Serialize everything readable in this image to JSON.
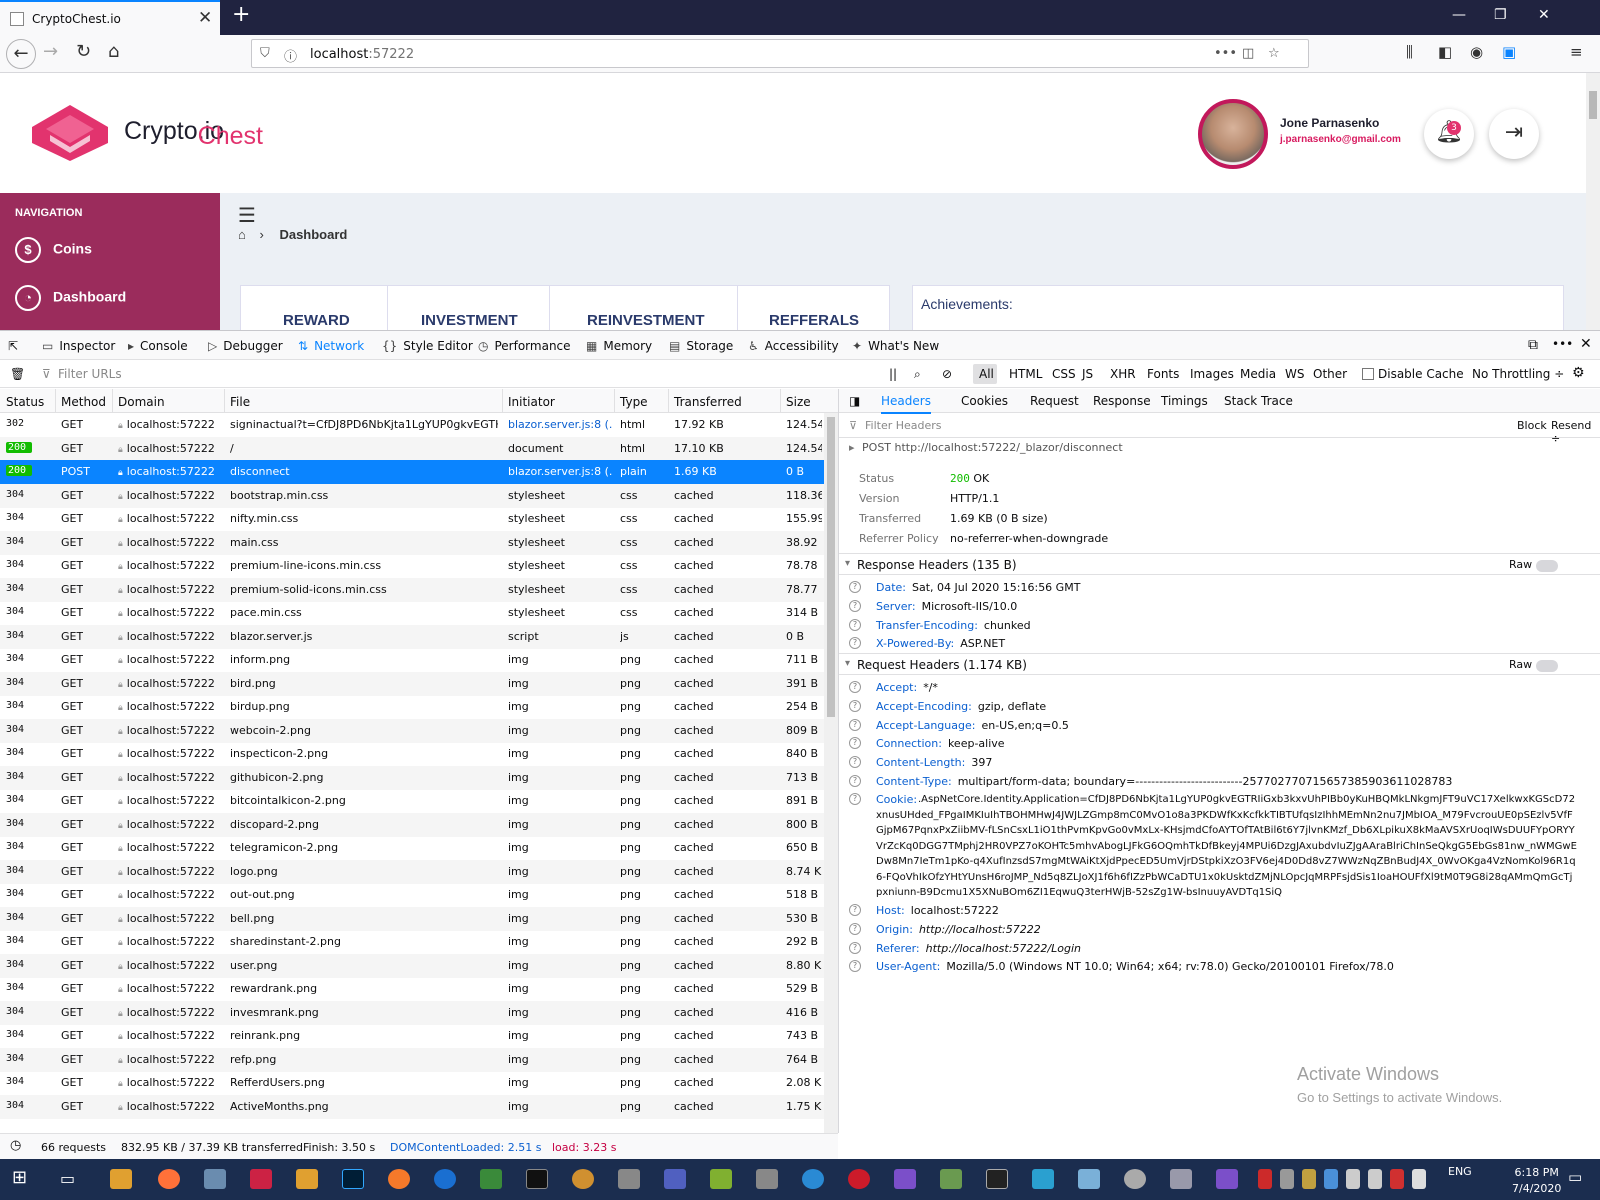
{
  "browser": {
    "tab_title": "CryptoChest.io",
    "url_host": "localhost",
    "url_port": ":57222"
  },
  "page": {
    "brand_a": "Crypto",
    "brand_b": "Chest",
    "brand_c": ".io",
    "user_name": "Jone Parnasenko",
    "user_email": "j.parnasenko@gmail.com",
    "notification_count": "3",
    "nav_heading": "NAVIGATION",
    "nav_items": [
      "Coins",
      "Dashboard"
    ],
    "breadcrumb": "Dashboard",
    "tabs": [
      "REWARD",
      "INVESTMENT",
      "REINVESTMENT",
      "REFFERALS"
    ],
    "achievements": "Achievements:"
  },
  "devtools": {
    "tools": [
      "Inspector",
      "Console",
      "Debugger",
      "Network",
      "Style Editor",
      "Performance",
      "Memory",
      "Storage",
      "Accessibility",
      "What's New"
    ],
    "filter_placeholder": "Filter URLs",
    "type_filters": [
      "All",
      "HTML",
      "CSS",
      "JS",
      "XHR",
      "Fonts",
      "Images",
      "Media",
      "WS",
      "Other"
    ],
    "disable_cache": "Disable Cache",
    "throttling": "No Throttling ÷",
    "columns": [
      "Status",
      "Method",
      "Domain",
      "File",
      "Initiator",
      "Type",
      "Transferred",
      "Size"
    ],
    "requests": [
      {
        "status": "302",
        "method": "GET",
        "domain": "localhost:57222",
        "file": "signinactual?t=CfDJ8PD6NbKjta1LgYUP0gkvEGTHv...",
        "initiator": "blazor.server.js:8 (...",
        "type": "html",
        "transferred": "17.92 KB",
        "size": "124.54 ..."
      },
      {
        "status": "200",
        "method": "GET",
        "domain": "localhost:57222",
        "file": "/",
        "initiator": "document",
        "type": "html",
        "transferred": "17.10 KB",
        "size": "124.54 ..."
      },
      {
        "status": "200",
        "method": "POST",
        "domain": "localhost:57222",
        "file": "disconnect",
        "initiator": "blazor.server.js:8 (...",
        "type": "plain",
        "transferred": "1.69 KB",
        "size": "0 B"
      },
      {
        "status": "304",
        "method": "GET",
        "domain": "localhost:57222",
        "file": "bootstrap.min.css",
        "initiator": "stylesheet",
        "type": "css",
        "transferred": "cached",
        "size": "118.36 ..."
      },
      {
        "status": "304",
        "method": "GET",
        "domain": "localhost:57222",
        "file": "nifty.min.css",
        "initiator": "stylesheet",
        "type": "css",
        "transferred": "cached",
        "size": "155.99 ..."
      },
      {
        "status": "304",
        "method": "GET",
        "domain": "localhost:57222",
        "file": "main.css",
        "initiator": "stylesheet",
        "type": "css",
        "transferred": "cached",
        "size": "38.92 KB"
      },
      {
        "status": "304",
        "method": "GET",
        "domain": "localhost:57222",
        "file": "premium-line-icons.min.css",
        "initiator": "stylesheet",
        "type": "css",
        "transferred": "cached",
        "size": "78.78 KB"
      },
      {
        "status": "304",
        "method": "GET",
        "domain": "localhost:57222",
        "file": "premium-solid-icons.min.css",
        "initiator": "stylesheet",
        "type": "css",
        "transferred": "cached",
        "size": "78.77 KB"
      },
      {
        "status": "304",
        "method": "GET",
        "domain": "localhost:57222",
        "file": "pace.min.css",
        "initiator": "stylesheet",
        "type": "css",
        "transferred": "cached",
        "size": "314 B"
      },
      {
        "status": "304",
        "method": "GET",
        "domain": "localhost:57222",
        "file": "blazor.server.js",
        "initiator": "script",
        "type": "js",
        "transferred": "cached",
        "size": "0 B"
      },
      {
        "status": "304",
        "method": "GET",
        "domain": "localhost:57222",
        "file": "inform.png",
        "initiator": "img",
        "type": "png",
        "transferred": "cached",
        "size": "711 B"
      },
      {
        "status": "304",
        "method": "GET",
        "domain": "localhost:57222",
        "file": "bird.png",
        "initiator": "img",
        "type": "png",
        "transferred": "cached",
        "size": "391 B"
      },
      {
        "status": "304",
        "method": "GET",
        "domain": "localhost:57222",
        "file": "birdup.png",
        "initiator": "img",
        "type": "png",
        "transferred": "cached",
        "size": "254 B"
      },
      {
        "status": "304",
        "method": "GET",
        "domain": "localhost:57222",
        "file": "webcoin-2.png",
        "initiator": "img",
        "type": "png",
        "transferred": "cached",
        "size": "809 B"
      },
      {
        "status": "304",
        "method": "GET",
        "domain": "localhost:57222",
        "file": "inspecticon-2.png",
        "initiator": "img",
        "type": "png",
        "transferred": "cached",
        "size": "840 B"
      },
      {
        "status": "304",
        "method": "GET",
        "domain": "localhost:57222",
        "file": "githubicon-2.png",
        "initiator": "img",
        "type": "png",
        "transferred": "cached",
        "size": "713 B"
      },
      {
        "status": "304",
        "method": "GET",
        "domain": "localhost:57222",
        "file": "bitcointalkicon-2.png",
        "initiator": "img",
        "type": "png",
        "transferred": "cached",
        "size": "891 B"
      },
      {
        "status": "304",
        "method": "GET",
        "domain": "localhost:57222",
        "file": "discopard-2.png",
        "initiator": "img",
        "type": "png",
        "transferred": "cached",
        "size": "800 B"
      },
      {
        "status": "304",
        "method": "GET",
        "domain": "localhost:57222",
        "file": "telegramicon-2.png",
        "initiator": "img",
        "type": "png",
        "transferred": "cached",
        "size": "650 B"
      },
      {
        "status": "304",
        "method": "GET",
        "domain": "localhost:57222",
        "file": "logo.png",
        "initiator": "img",
        "type": "png",
        "transferred": "cached",
        "size": "8.74 KB"
      },
      {
        "status": "304",
        "method": "GET",
        "domain": "localhost:57222",
        "file": "out-out.png",
        "initiator": "img",
        "type": "png",
        "transferred": "cached",
        "size": "518 B"
      },
      {
        "status": "304",
        "method": "GET",
        "domain": "localhost:57222",
        "file": "bell.png",
        "initiator": "img",
        "type": "png",
        "transferred": "cached",
        "size": "530 B"
      },
      {
        "status": "304",
        "method": "GET",
        "domain": "localhost:57222",
        "file": "sharedinstant-2.png",
        "initiator": "img",
        "type": "png",
        "transferred": "cached",
        "size": "292 B"
      },
      {
        "status": "304",
        "method": "GET",
        "domain": "localhost:57222",
        "file": "user.png",
        "initiator": "img",
        "type": "png",
        "transferred": "cached",
        "size": "8.80 KB"
      },
      {
        "status": "304",
        "method": "GET",
        "domain": "localhost:57222",
        "file": "rewardrank.png",
        "initiator": "img",
        "type": "png",
        "transferred": "cached",
        "size": "529 B"
      },
      {
        "status": "304",
        "method": "GET",
        "domain": "localhost:57222",
        "file": "invesmrank.png",
        "initiator": "img",
        "type": "png",
        "transferred": "cached",
        "size": "416 B"
      },
      {
        "status": "304",
        "method": "GET",
        "domain": "localhost:57222",
        "file": "reinrank.png",
        "initiator": "img",
        "type": "png",
        "transferred": "cached",
        "size": "743 B"
      },
      {
        "status": "304",
        "method": "GET",
        "domain": "localhost:57222",
        "file": "refp.png",
        "initiator": "img",
        "type": "png",
        "transferred": "cached",
        "size": "764 B"
      },
      {
        "status": "304",
        "method": "GET",
        "domain": "localhost:57222",
        "file": "RefferdUsers.png",
        "initiator": "img",
        "type": "png",
        "transferred": "cached",
        "size": "2.08 KB"
      },
      {
        "status": "304",
        "method": "GET",
        "domain": "localhost:57222",
        "file": "ActiveMonths.png",
        "initiator": "img",
        "type": "png",
        "transferred": "cached",
        "size": "1.75 KB"
      }
    ],
    "details": {
      "tabs": [
        "Headers",
        "Cookies",
        "Request",
        "Response",
        "Timings",
        "Stack Trace"
      ],
      "filter_placeholder": "Filter Headers",
      "block": "Block",
      "resend": "Resend ÷",
      "summary": "POST  http://localhost:57222/_blazor/disconnect",
      "status_label": "Status",
      "status_code": "200",
      "status_text": "OK",
      "version_label": "Version",
      "version": "HTTP/1.1",
      "transferred_label": "Transferred",
      "transferred": "1.69 KB (0 B size)",
      "referrer_label": "Referrer Policy",
      "referrer": "no-referrer-when-downgrade",
      "resp_title": "Response Headers (135 B)",
      "req_title": "Request Headers (1.174 KB)",
      "raw": "Raw",
      "response_headers": [
        {
          "name": "Date:",
          "value": "Sat, 04 Jul 2020 15:16:56 GMT"
        },
        {
          "name": "Server:",
          "value": "Microsoft-IIS/10.0"
        },
        {
          "name": "Transfer-Encoding:",
          "value": "chunked"
        },
        {
          "name": "X-Powered-By:",
          "value": "ASP.NET"
        }
      ],
      "request_headers": [
        {
          "name": "Accept:",
          "value": "*/*"
        },
        {
          "name": "Accept-Encoding:",
          "value": "gzip, deflate"
        },
        {
          "name": "Accept-Language:",
          "value": "en-US,en;q=0.5"
        },
        {
          "name": "Connection:",
          "value": "keep-alive"
        },
        {
          "name": "Content-Length:",
          "value": "397"
        },
        {
          "name": "Content-Type:",
          "value": "multipart/form-data; boundary=---------------------------257702770715657385903611028783"
        }
      ],
      "cookie_name": "Cookie:",
      "cookie_value": ".AspNetCore.Identity.Application=CfDJ8PD6NbKjta1LgYUP0gkvEGTRIiGxb3kxvUhPIBb0yKuHBQMkLNkgmJFT9uVC17XelkwxKGScD72xnusUHded_FPgaIMKIuIhTBOHMHwJ4JWJLZGmp8mC0MvO1o8a3PKDWfKxKcfkkTIBTUfqsIzIhhMEmNn2nu7JMbIOA_M79FvcrouUE0pSEzlv5VfFGjpM67PqnxPxZiibMV-fLSnCsxL1iO1thPvmKpvGo0vMxLx-KHsjmdCfoAYTOfTAtBil6t6Y7jlvnKMzf_Db6XLpikuX8kMaAVSXrUoqIWsDUUFYpORYYVrZcKq0DGG7TMphj2HR0VPZ7oKOHTc5mhvAbogLJFkG6OQmhTkDfBkeyj4MPUi6DzgJAxubdvIuZJgAAraBlriChInSeQkgG5EbGs81nw_nWMGwEDw8Mn7IeTm1pKo-q4XufInzsdS7mgMtWAiKtXjdPpecED5UmVjrDStpkiXzO3FV6ej4D0Dd8vZ7WWzNqZBnBudJ4X_0WvOKga4VzNomKol96R1q6-FQoVhIkOfzYHtYUnsH6roJMP_Nd5q8ZLJoXJ1f6h6fIZzPbWCaDTU1x0kUsktdZMjNLOpcJqMRPFsjdSis1IoaHOUFfXl9tM0T9G8i28qAMmQmGcTjpxniunn-B9Dcmu1X5XNuBOm6ZI1EqwuQ3terHWjB-52sZg1W-bsInuuyAVDTq1SiQ",
      "request_headers_after": [
        {
          "name": "Host:",
          "value": "localhost:57222"
        },
        {
          "name": "Origin:",
          "value": "http://localhost:57222"
        },
        {
          "name": "Referer:",
          "value": "http://localhost:57222/Login"
        },
        {
          "name": "User-Agent:",
          "value": "Mozilla/5.0 (Windows NT 10.0; Win64; x64; rv:78.0) Gecko/20100101 Firefox/78.0"
        }
      ]
    },
    "status_bar": {
      "requests": "66 requests",
      "transferred": "832.95 KB / 37.39 KB transferred",
      "finish": "Finish: 3.50 s",
      "dcl": "DOMContentLoaded: 2.51 s",
      "load": "load: 3.23 s"
    }
  },
  "watermark": {
    "line1": "Activate Windows",
    "line2": "Go to Settings to activate Windows."
  },
  "taskbar": {
    "lang": "ENG",
    "time": "6:18 PM",
    "date": "7/4/2020"
  },
  "colors": {
    "accent": "#0a84ff",
    "brand_pink": "#e2336e",
    "sidebar": "#9b2c5c",
    "status_ok": "#12bc00"
  }
}
